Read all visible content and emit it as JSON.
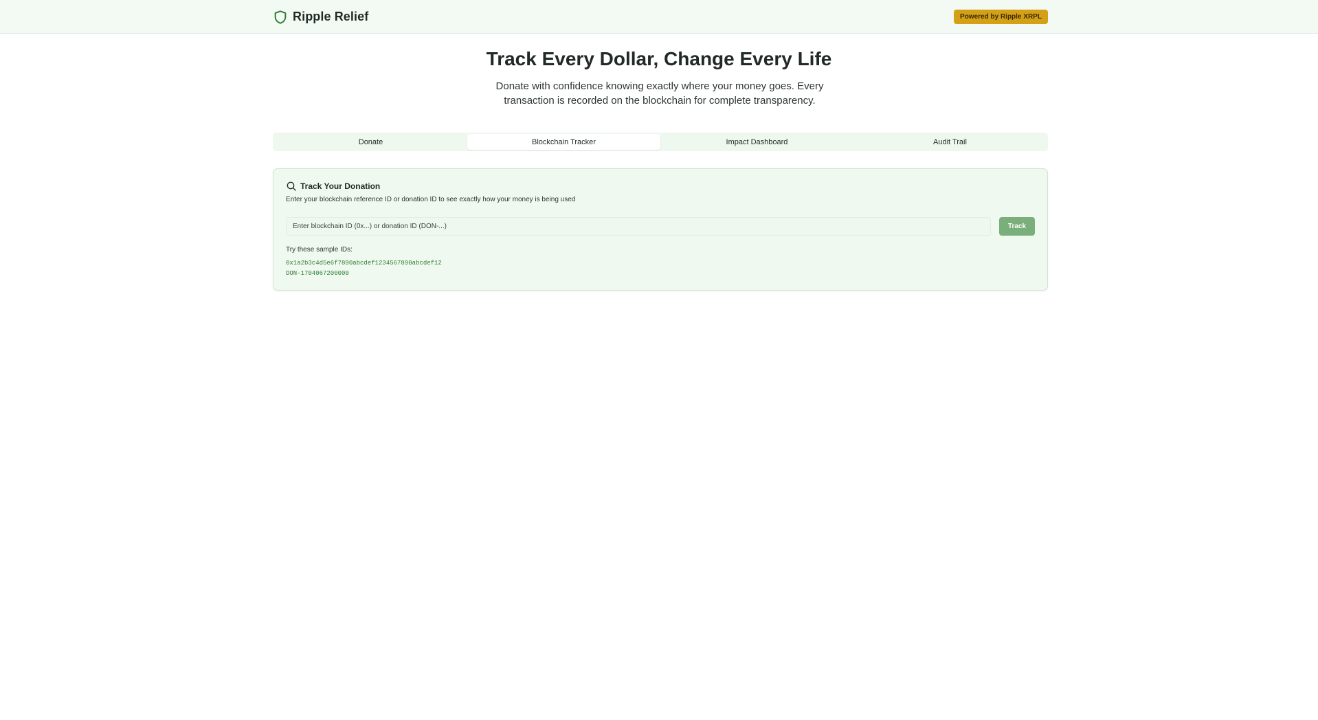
{
  "header": {
    "brand": "Ripple Relief",
    "badge": "Powered by Ripple XRPL",
    "icon": "shield-icon"
  },
  "hero": {
    "title": "Track Every Dollar, Change Every Life",
    "subtitle": "Donate with confidence knowing exactly where your money goes. Every transaction is recorded on the blockchain for complete transparency."
  },
  "tabs": [
    {
      "label": "Donate",
      "active": false
    },
    {
      "label": "Blockchain Tracker",
      "active": true
    },
    {
      "label": "Impact Dashboard",
      "active": false
    },
    {
      "label": "Audit Trail",
      "active": false
    }
  ],
  "tracker": {
    "icon": "search-icon",
    "title": "Track Your Donation",
    "description": "Enter your blockchain reference ID or donation ID to see exactly how your money is being used",
    "input_placeholder": "Enter blockchain ID (0x...) or donation ID (DON-...)",
    "input_value": "",
    "button_label": "Track",
    "samples_label": "Try these sample IDs:",
    "samples": [
      "0x1a2b3c4d5e6f7890abcdef1234567890abcdef12",
      "DON-1704067200000"
    ]
  },
  "colors": {
    "header_bg": "#f3faf3",
    "badge_bg": "#d4a017",
    "accent_green": "#2e7d32",
    "button_bg": "#7aae7a",
    "card_bg": "#f0f9f0"
  }
}
